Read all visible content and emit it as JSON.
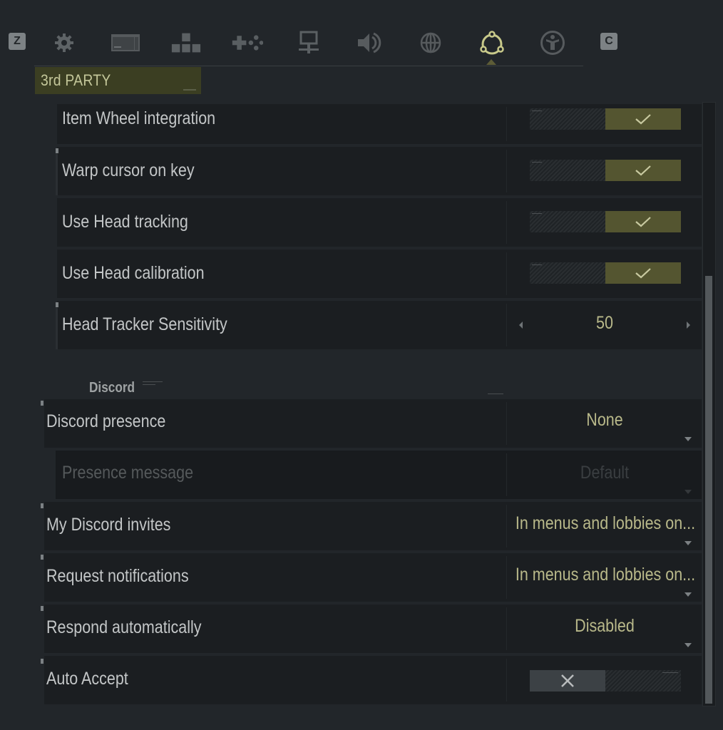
{
  "topbar": {
    "left_key": "Z",
    "right_key": "C",
    "tabs": [
      {
        "name": "general",
        "icon": "gear-icon",
        "active": false
      },
      {
        "name": "display",
        "icon": "display-icon",
        "active": false
      },
      {
        "name": "keybindings",
        "icon": "keyboard-arrows-icon",
        "active": false
      },
      {
        "name": "controller",
        "icon": "gamepad-icon",
        "active": false
      },
      {
        "name": "network",
        "icon": "network-icon",
        "active": false
      },
      {
        "name": "audio",
        "icon": "speaker-icon",
        "active": false
      },
      {
        "name": "language",
        "icon": "globe-icon",
        "active": false
      },
      {
        "name": "3rd-party",
        "icon": "third-party-icon",
        "active": true
      },
      {
        "name": "accessibility",
        "icon": "accessibility-icon",
        "active": false
      }
    ],
    "accent_color": "#c8c98a"
  },
  "section": {
    "title": "3rd PARTY"
  },
  "settings": [
    {
      "label": "Item Wheel integration",
      "type": "toggle",
      "value": true
    },
    {
      "label": "Warp cursor on key",
      "type": "toggle",
      "value": true
    },
    {
      "label": "Use Head tracking",
      "type": "toggle",
      "value": true
    },
    {
      "label": "Use Head calibration",
      "type": "toggle",
      "value": true
    },
    {
      "label": "Head Tracker Sensitivity",
      "type": "stepper",
      "value": "50"
    }
  ],
  "discord": {
    "title": "Discord",
    "settings": [
      {
        "label": "Discord presence",
        "type": "dropdown",
        "value": "None",
        "disabled": false
      },
      {
        "label": "Presence message",
        "type": "dropdown",
        "value": "Default",
        "disabled": true
      },
      {
        "label": "My Discord invites",
        "type": "dropdown",
        "value": "In menus and lobbies on...",
        "disabled": false
      },
      {
        "label": "Request notifications",
        "type": "dropdown",
        "value": "In menus and lobbies on...",
        "disabled": false
      },
      {
        "label": "Respond automatically",
        "type": "dropdown",
        "value": "Disabled",
        "disabled": false
      },
      {
        "label": "Auto Accept",
        "type": "toggle",
        "value": false,
        "disabled": false
      }
    ]
  },
  "scrollbar": {
    "position_fraction": 0.29
  }
}
